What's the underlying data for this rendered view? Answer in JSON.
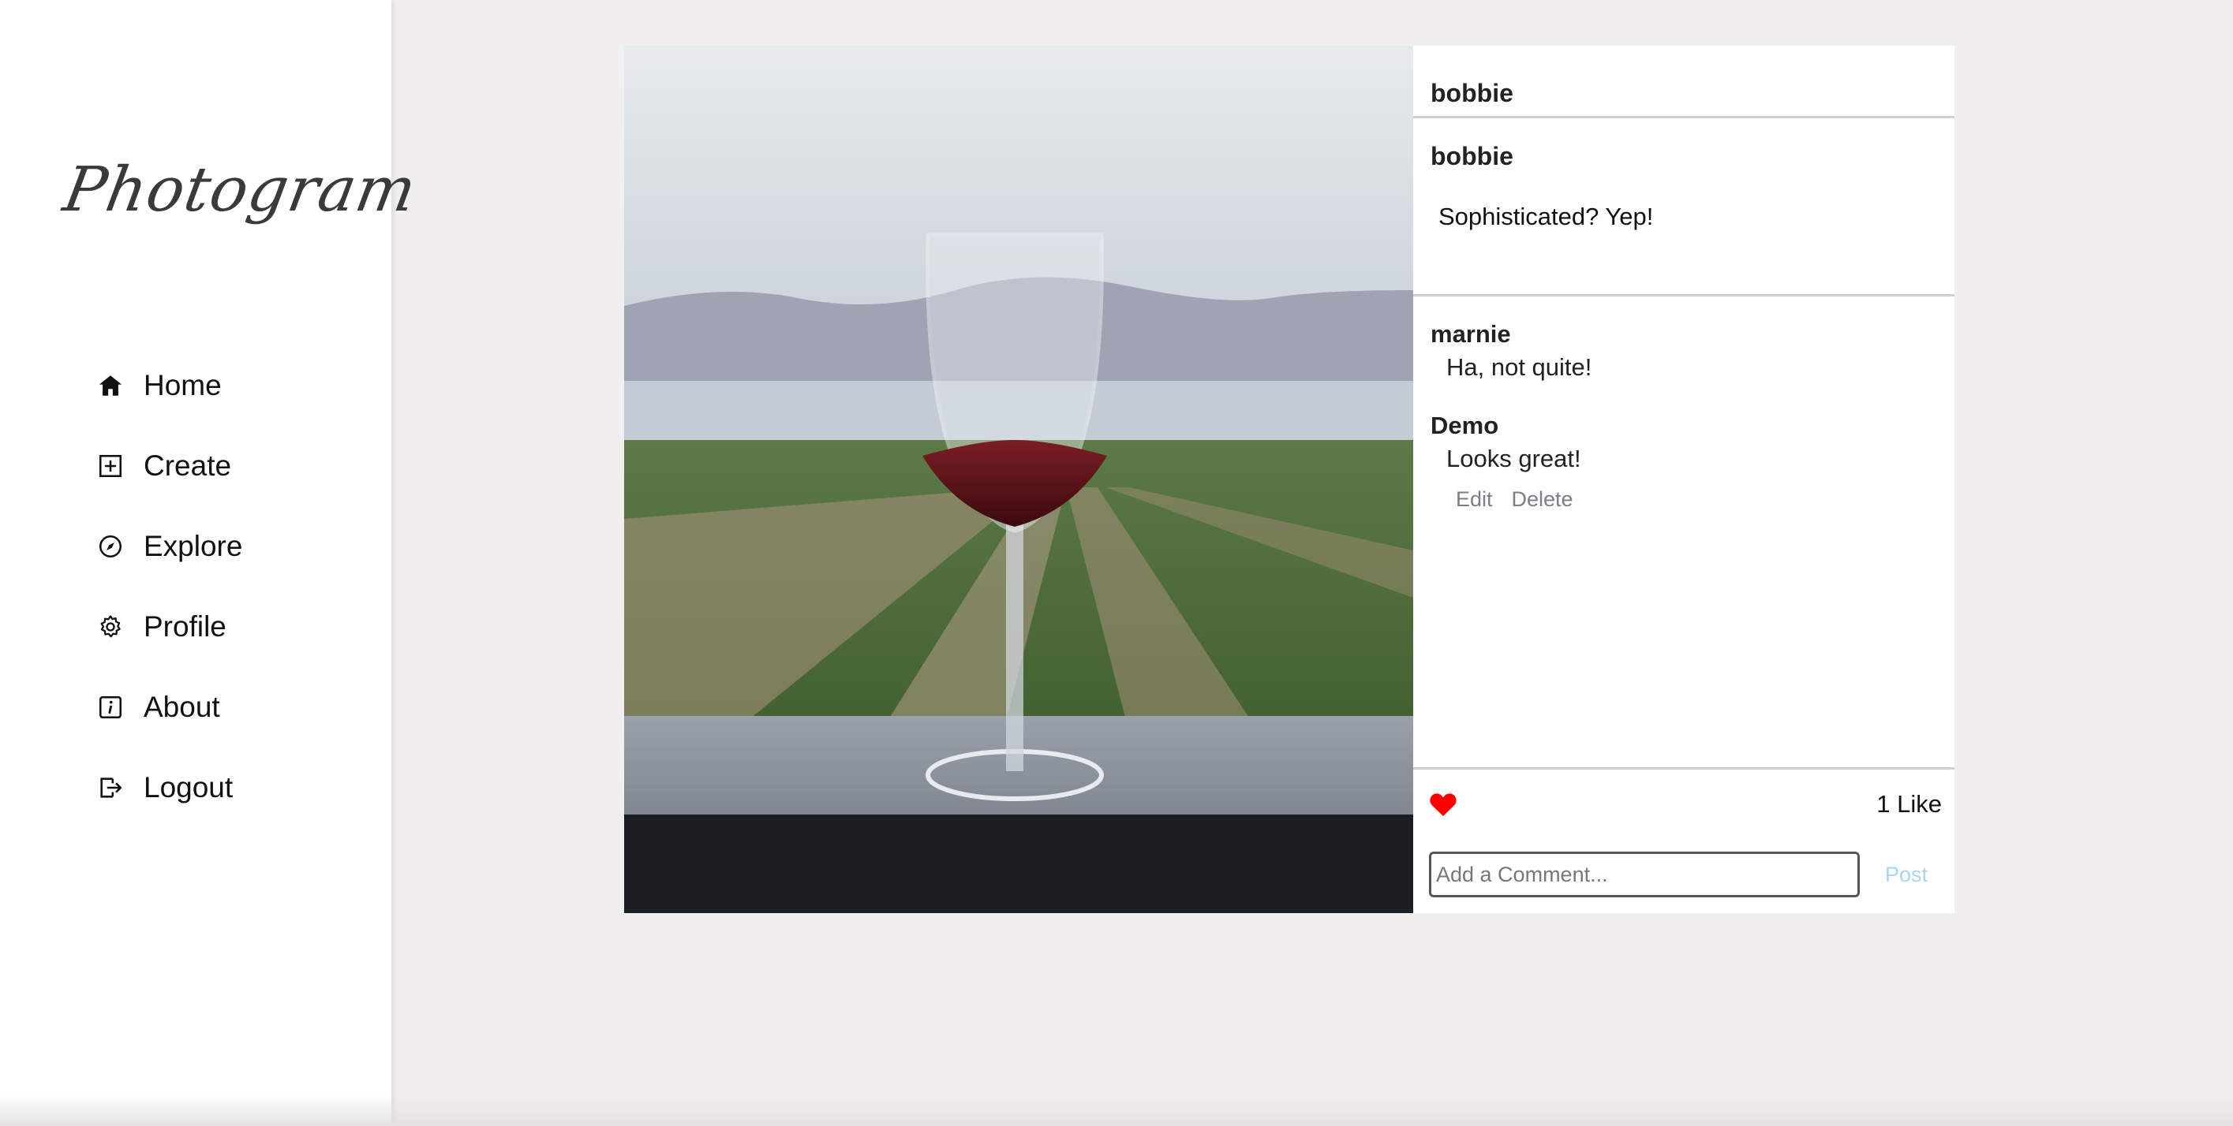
{
  "sidebar": {
    "logo": "Photogram",
    "items": [
      {
        "label": "Home",
        "icon": "home-icon"
      },
      {
        "label": "Create",
        "icon": "plus-square-icon"
      },
      {
        "label": "Explore",
        "icon": "compass-icon"
      },
      {
        "label": "Profile",
        "icon": "gear-icon"
      },
      {
        "label": "About",
        "icon": "info-icon"
      },
      {
        "label": "Logout",
        "icon": "logout-icon"
      }
    ]
  },
  "post": {
    "author": "bobbie",
    "caption_author": "bobbie",
    "caption": "Sophisticated? Yep!",
    "comments": [
      {
        "user": "marnie",
        "text": "Ha, not quite!"
      },
      {
        "user": "Demo",
        "text": "Looks great!",
        "actions": {
          "edit": "Edit",
          "delete": "Delete"
        }
      }
    ],
    "likes": "1 Like",
    "comment_placeholder": "Add a Comment...",
    "post_label": "Post"
  },
  "colors": {
    "heart": "#ff0000",
    "post_link": "#a8d4f7",
    "action_link": "#7a7f86"
  }
}
